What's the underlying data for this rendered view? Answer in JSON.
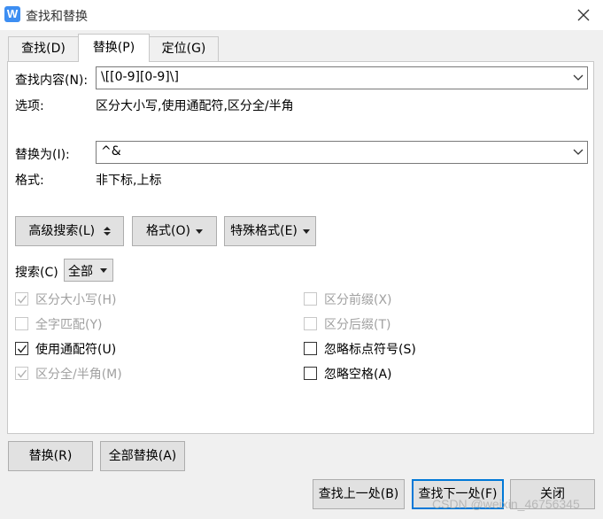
{
  "window": {
    "title": "查找和替换",
    "app_icon_letter": "W",
    "accent_color": "#3d8ef2"
  },
  "tabs": [
    {
      "label": "查找(D)",
      "active": false
    },
    {
      "label": "替换(P)",
      "active": true
    },
    {
      "label": "定位(G)",
      "active": false
    }
  ],
  "find": {
    "label": "查找内容(N):",
    "value": "\\[[0-9][0-9]\\]",
    "options_label": "选项:",
    "options_value": "区分大小写,使用通配符,区分全/半角"
  },
  "replace": {
    "label": "替换为(I):",
    "value": "^&",
    "format_label": "格式:",
    "format_value": "非下标,上标"
  },
  "toolbar": {
    "advanced_search": "高级搜索(L)",
    "format": "格式(O)",
    "special_format": "特殊格式(E)"
  },
  "search": {
    "label": "搜索(C)",
    "selected": "全部"
  },
  "checkboxes_left": [
    {
      "label": "区分大小写(H)",
      "checked": true,
      "disabled": true
    },
    {
      "label": "全字匹配(Y)",
      "checked": false,
      "disabled": true
    },
    {
      "label": "使用通配符(U)",
      "checked": true,
      "disabled": false
    },
    {
      "label": "区分全/半角(M)",
      "checked": true,
      "disabled": true
    }
  ],
  "checkboxes_right": [
    {
      "label": "区分前缀(X)",
      "checked": false,
      "disabled": true
    },
    {
      "label": "区分后缀(T)",
      "checked": false,
      "disabled": true
    },
    {
      "label": "忽略标点符号(S)",
      "checked": false,
      "disabled": false
    },
    {
      "label": "忽略空格(A)",
      "checked": false,
      "disabled": false
    }
  ],
  "actions": {
    "replace": "替换(R)",
    "replace_all": "全部替换(A)",
    "find_prev": "查找上一处(B)",
    "find_next": "查找下一处(F)",
    "close": "关闭"
  },
  "watermark": "CSDN @weixin_46756345"
}
